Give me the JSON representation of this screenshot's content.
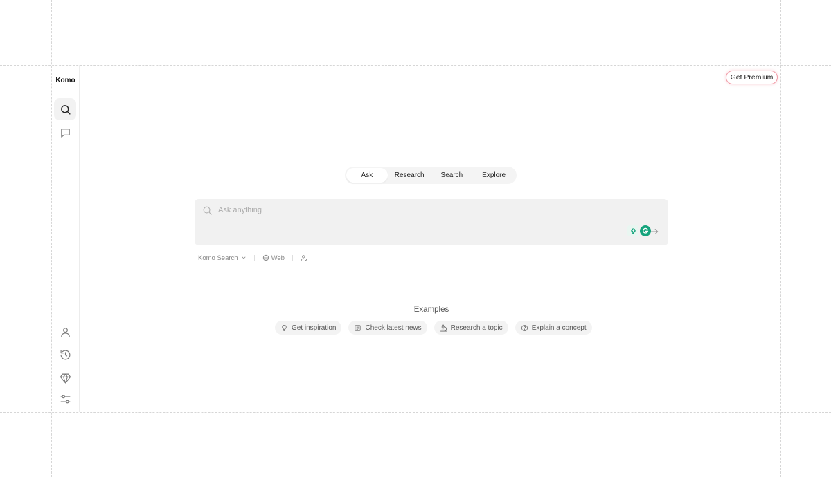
{
  "brand": "Komo",
  "premium_label": "Get Premium",
  "tabs": [
    {
      "label": "Ask",
      "active": true
    },
    {
      "label": "Research",
      "active": false
    },
    {
      "label": "Search",
      "active": false
    },
    {
      "label": "Explore",
      "active": false
    }
  ],
  "search": {
    "placeholder": "Ask anything"
  },
  "options": {
    "engine_label": "Komo Search",
    "source_label": "Web"
  },
  "examples": {
    "title": "Examples",
    "chips": [
      {
        "label": "Get inspiration",
        "icon": "lightbulb-icon"
      },
      {
        "label": "Check latest news",
        "icon": "newspaper-icon"
      },
      {
        "label": "Research a topic",
        "icon": "microscope-icon"
      },
      {
        "label": "Explain a concept",
        "icon": "question-circle-icon"
      }
    ]
  },
  "sidebar_icons": [
    "search-icon",
    "chat-icon",
    "user-icon",
    "history-icon",
    "diamond-icon",
    "settings-sliders-icon"
  ],
  "colors": {
    "premium_border": "#f19aa6",
    "extension_green": "#15a37c"
  }
}
